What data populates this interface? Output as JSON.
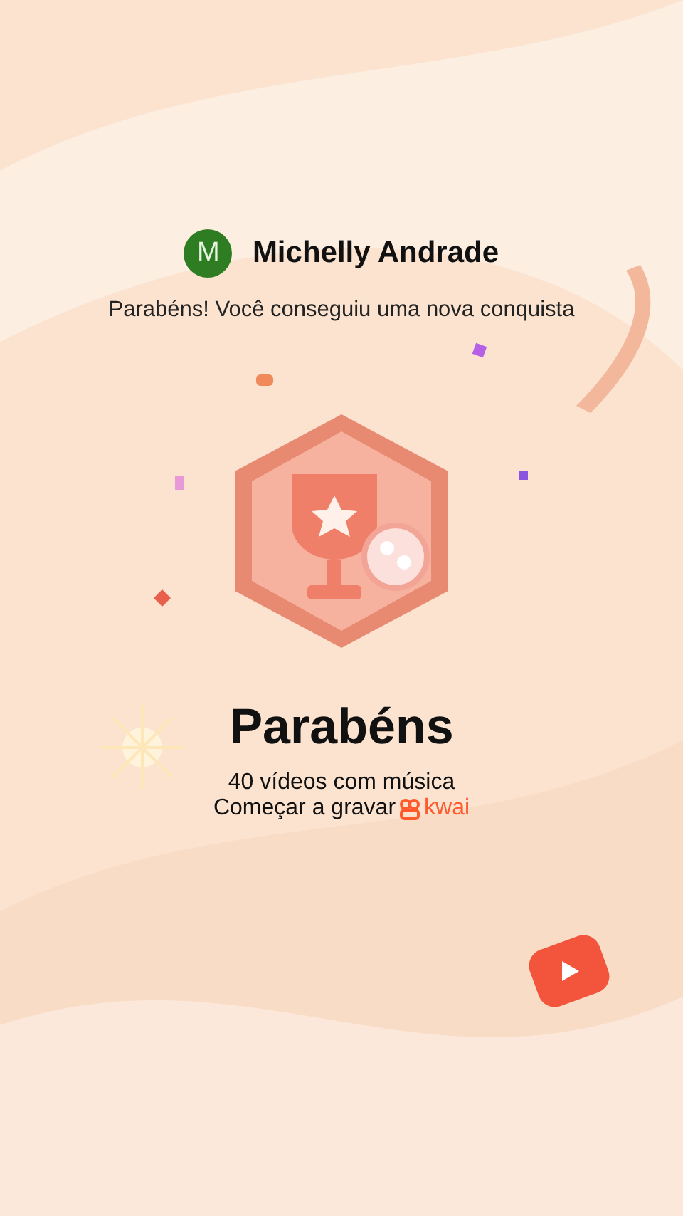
{
  "user": {
    "avatar_letter": "M",
    "name": "Michelly Andrade"
  },
  "message": "Parabéns! Você conseguiu uma nova conquista",
  "achievement": {
    "title": "Parabéns",
    "description": "40 vídeos com música",
    "action": "Começar a gravar",
    "brand": "kwai"
  }
}
